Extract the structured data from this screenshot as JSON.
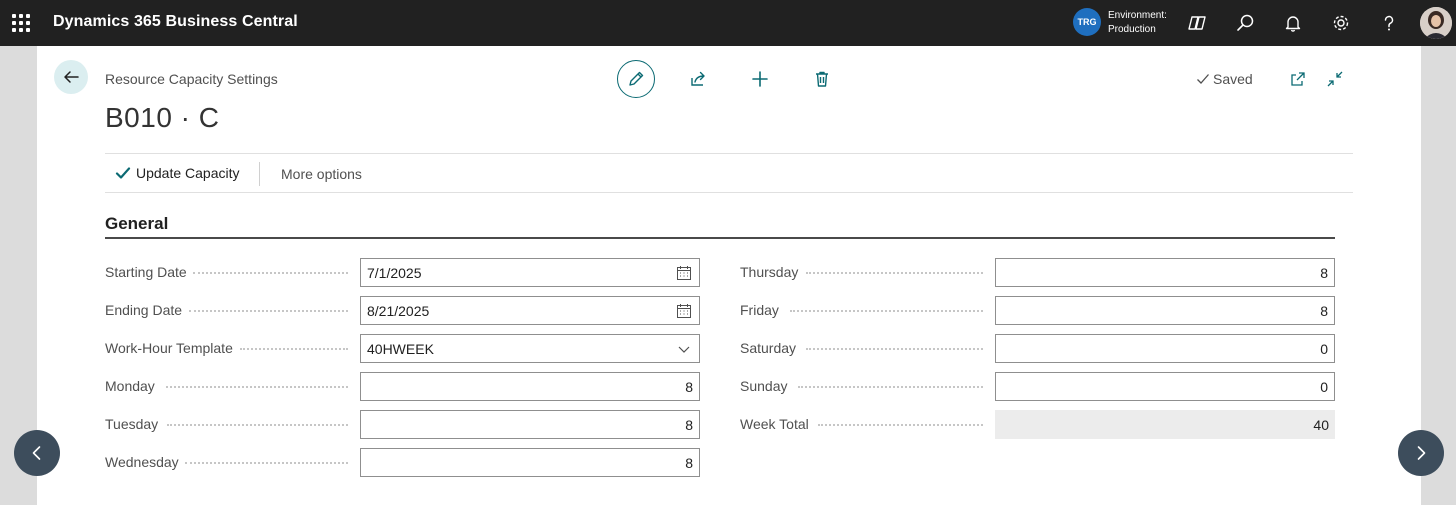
{
  "topbar": {
    "app_title": "Dynamics 365 Business Central",
    "env_badge": "TRG",
    "env_label": "Environment:",
    "env_value": "Production",
    "icons": [
      "copilot-icon",
      "search-icon",
      "bell-icon",
      "gear-icon",
      "help-icon",
      "avatar"
    ]
  },
  "header": {
    "breadcrumb": "Resource Capacity Settings",
    "title": "B010 · C",
    "saved_label": "Saved"
  },
  "actions": {
    "update_capacity": "Update Capacity",
    "more_options": "More options"
  },
  "section": {
    "title": "General"
  },
  "fields_left": [
    {
      "label": "Starting Date",
      "value": "7/1/2025",
      "kind": "date"
    },
    {
      "label": "Ending Date",
      "value": "8/21/2025",
      "kind": "date"
    },
    {
      "label": "Work-Hour Template",
      "value": "40HWEEK",
      "kind": "select"
    },
    {
      "label": "Monday",
      "value": "8",
      "kind": "number"
    },
    {
      "label": "Tuesday",
      "value": "8",
      "kind": "number"
    },
    {
      "label": "Wednesday",
      "value": "8",
      "kind": "number"
    }
  ],
  "fields_right": [
    {
      "label": "Thursday",
      "value": "8",
      "kind": "number"
    },
    {
      "label": "Friday",
      "value": "8",
      "kind": "number"
    },
    {
      "label": "Saturday",
      "value": "0",
      "kind": "number"
    },
    {
      "label": "Sunday",
      "value": "0",
      "kind": "number"
    },
    {
      "label": "Week Total",
      "value": "40",
      "kind": "readonly"
    }
  ],
  "colors": {
    "topbar": "#212121",
    "accent": "#0b6a73",
    "env_badge": "#1f6fbf",
    "nav_circle": "#3d4d5c"
  }
}
